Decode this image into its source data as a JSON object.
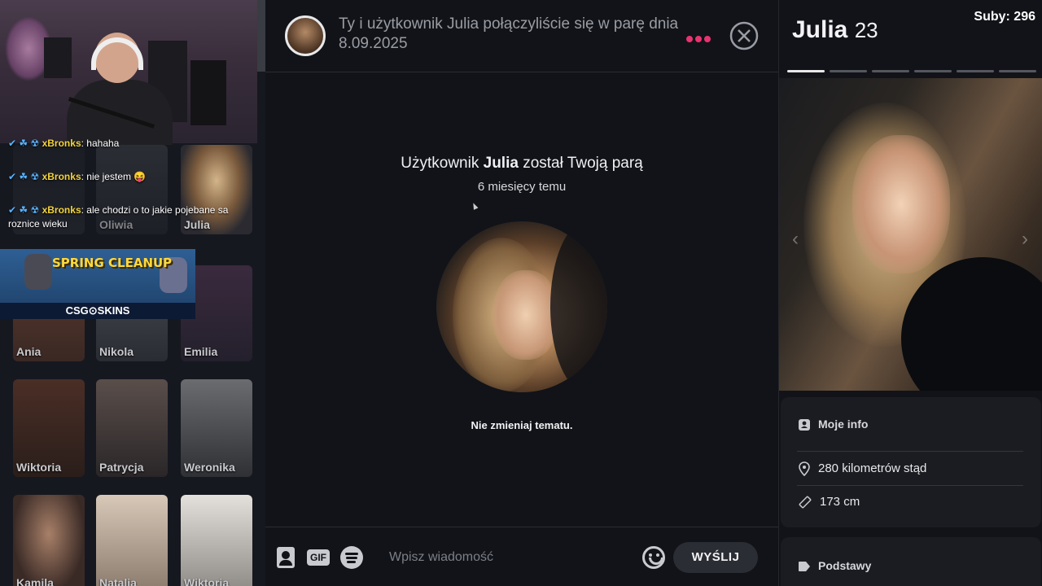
{
  "stream": {
    "chat": [
      {
        "badges": "✔ ☘ ☢",
        "user": "xBronks",
        "text": "hahaha"
      },
      {
        "badges": "✔ ☘ ☢",
        "user": "xBronks",
        "text": "nie jestem 😝"
      },
      {
        "badges": "✔ ☘ ☢",
        "user": "xBronks",
        "text": "ale chodzi o to jakie pojebane sa roznice wieku"
      }
    ],
    "ad": {
      "title": "SPRING CLEANUP",
      "brand": "CSG⊙SKINS"
    }
  },
  "matches": [
    {
      "name": "Oliwia"
    },
    {
      "name": "Julia"
    },
    {
      "name": "Ania"
    },
    {
      "name": "Nikola"
    },
    {
      "name": "Emilia"
    },
    {
      "name": "Wiktoria"
    },
    {
      "name": "Patrycja"
    },
    {
      "name": "Weronika"
    },
    {
      "name": "Kamila"
    },
    {
      "name": "Natalia"
    },
    {
      "name": "Wiktoria"
    }
  ],
  "conversation": {
    "header_text": "Ty i użytkownik Julia połączyliście się w parę dnia 8.09.2025",
    "match_prefix": "Użytkownik ",
    "match_name": "Julia",
    "match_suffix": " został Twoją parą",
    "match_time": "6 miesięcy temu",
    "topic_hint": "Nie zmieniaj tematu."
  },
  "composer": {
    "gif_label": "GIF",
    "placeholder": "Wpisz wiadomość",
    "send_label": "WYŚLIJ"
  },
  "profile": {
    "name": "Julia",
    "age": "23",
    "subs": "Suby: 296",
    "photo_count": 6,
    "active_photo_index": 0,
    "info_title": "Moje info",
    "distance": "280 kilometrów stąd",
    "height": "173 cm",
    "basics_title": "Podstawy"
  },
  "colors": {
    "accent": "#e8336f",
    "bg": "#111318",
    "card": "#1a1c22"
  }
}
